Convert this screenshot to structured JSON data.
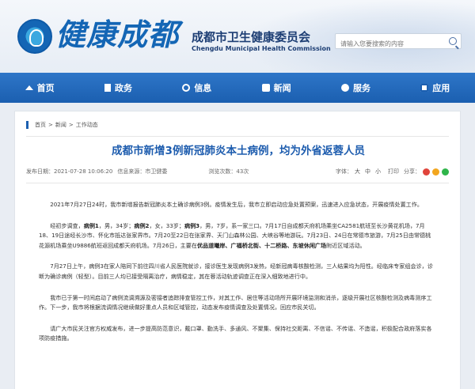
{
  "header": {
    "logo_text": "健康成都",
    "org_name_cn": "成都市卫生健康委员会",
    "org_name_en": "Chengdu Municipal Health Commission",
    "search_placeholder": "请输入您要搜索的内容"
  },
  "nav": [
    {
      "label": "首页",
      "icon": "home-icon"
    },
    {
      "label": "政务",
      "icon": "document-icon"
    },
    {
      "label": "信息",
      "icon": "info-icon"
    },
    {
      "label": "新闻",
      "icon": "news-icon"
    },
    {
      "label": "服务",
      "icon": "service-icon"
    },
    {
      "label": "应用",
      "icon": "app-icon"
    }
  ],
  "breadcrumb": {
    "home": "首页",
    "sep": ">",
    "news": "新闻",
    "current": "工作动态"
  },
  "article": {
    "title": "成都市新增3例新冠肺炎本土病例，均为外省返蓉人员",
    "published": "发布日期：2021-07-28 10:06:20",
    "source": "信息来源：市卫健委",
    "views": "浏览次数：43次",
    "font_label": "字体：",
    "font_large": "大",
    "font_medium": "中",
    "font_small": "小",
    "print": "打印",
    "share": "分享：",
    "paragraphs": [
      [
        {
          "t": "2021年7月27日24时，我市新增报告新冠肺炎本土确诊病例3例。疫情发生后，我市立即启动应急处置预案，迅速进入应急状态，开展疫情处置工作。"
        }
      ],
      [
        {
          "t": "经初步调查，"
        },
        {
          "t": "病例1",
          "b": true
        },
        {
          "t": "，男，34岁；"
        },
        {
          "t": "病例2",
          "b": true
        },
        {
          "t": "，女，33岁；"
        },
        {
          "t": "病例3",
          "b": true
        },
        {
          "t": "，男，7岁，系一家三口。7月17日自成都天府机场乘坐CA2581航班至长沙黄花机场，7月18、19日途经长沙市、怀化市抵达张家界市。7月20至22日在张家界、天门山森林公园、大峡谷等地游玩。7月23日、24日在常德市旅游，7月25日由常德桃花源机场乘坐U9886航班返回成都天府机场。7月26日，主要在"
        },
        {
          "t": "优品道曦岸、广福桥北街、十二桥路、东坡休闲广场",
          "b": true
        },
        {
          "t": "附近区域活动。"
        }
      ],
      [
        {
          "t": "7月27日上午，病例3在家人陪同下前往四川省人民医院就诊，接诊医生发现病例3发热，经新冠病毒核酸检测，三人结果均为阳性。经临床专家组会诊，诊断为确诊病例（轻型）。目前三人均已接受隔离治疗，病情稳定，其在蓉活动轨迹调查正在深入细致地进行中。"
        }
      ],
      [
        {
          "t": "我市已于第一时间启动了病例流调溯源及密接者追踪排查管控工作，对其工作、居住等活动场所开展环境监测和消杀，逐级开展社区核酸检测及病毒测序工作。下一步，我市将根据流调情况继续做好重点人员和区域管控，动态发布疫情调查及处置情况，回应市民关切。"
        }
      ],
      [
        {
          "t": "请广大市民关注官方权威发布，进一步提高防范意识，戴口罩、勤洗手、多通风、不聚集、保持社交距离、不信谣、不传谣、不造谣，积极配合政府落实各项防疫措施。"
        }
      ]
    ]
  },
  "colors": {
    "brand": "#1466b5",
    "nav": "#1b5fb0",
    "title": "#1d5cae",
    "share_weibo": "#e0443b",
    "share_qzone": "#f2a61f",
    "share_wechat": "#2fb54a"
  }
}
